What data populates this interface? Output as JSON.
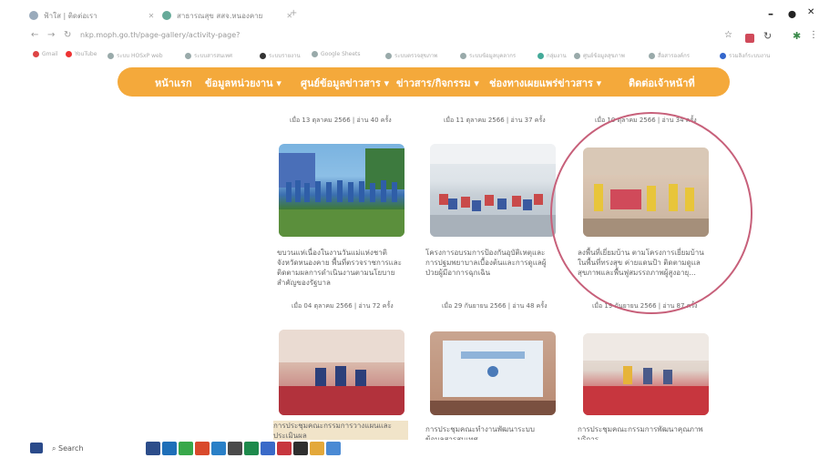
{
  "browser": {
    "tabs": [
      {
        "label": "ฟ้าใส | ติดต่อเรา"
      },
      {
        "label": "สาธารณสุข สสจ.หนองคาย"
      }
    ],
    "url": "nkp.moph.go.th/page-gallery/activity-page?",
    "new_tab": "+",
    "window_controls": {
      "minimize": "–",
      "maximize": "⬤",
      "close": "✕"
    },
    "bookmarks": [
      "Gmail",
      "YouTube",
      "ระบบ HOSxP web",
      "ระบบสารสนเทศ",
      "ระบบรายงาน",
      "Google Sheets",
      "ระบบตรวจสุขภาพ",
      "ระบบข้อมูลบุคลากร",
      "กลุ่มงาน",
      "ศูนย์ข้อมูลสุขภาพ",
      "สื่อสารองค์กร",
      "รวมลิงก์ระบบงาน"
    ]
  },
  "site_nav": {
    "items": [
      "หน้าแรก",
      "ข้อมูลหน่วยงาน ▾",
      "ศูนย์ข้อมูลข่าวสาร ▾",
      "ข่าวสาร/กิจกรรม ▾",
      "ช่องทางเผยแพร่ข่าวสาร ▾",
      "ติดต่อเจ้าหน้าที่"
    ]
  },
  "gallery": {
    "row1_meta": [
      "เมื่อ 13 ตุลาคม 2566 | อ่าน 40 ครั้ง",
      "เมื่อ 11 ตุลาคม 2566 | อ่าน 37 ครั้ง",
      "เมื่อ 10 ตุลาคม 2566 | อ่าน 34 ครั้ง"
    ],
    "cards": [
      {
        "title": "ขบวนแห่เนื่องในงานวันแม่แห่งชาติจังหวัดหนองคาย พื้นที่ตรวจราชการและติดตามผลการดำเนินงานตามนโยบายสำคัญของรัฐบาล",
        "meta": "เมื่อ 04 ตุลาคม 2566 | อ่าน 72 ครั้ง"
      },
      {
        "title": "โครงการอบรมการป้องกันอุบัติเหตุและการปฐมพยาบาลเบื้องต้นและการดูแลผู้ป่วยผู้มีอาการฉุกเฉิน",
        "meta": "เมื่อ 29 กันยายน 2566 | อ่าน 48 ครั้ง"
      },
      {
        "title": "ลงพื้นที่เยี่ยมบ้าน ตามโครงการเยี่ยมบ้านในพื้นที่ทรงสุข ค่ายแดนป้า ติดตามดูแลสุขภาพและพื้นฟูสมรรถภาพผู้สูงอายุ...",
        "meta": "เมื่อ 19 กันยายน 2566 | อ่าน 87 ครั้ง"
      }
    ],
    "row3_titles": [
      "การประชุมคณะกรรมการวางแผนและประเมินผล",
      "การประชุมคณะทำงานพัฒนาระบบข้อมูลสารสนเทศ",
      "การประชุมคณะกรรมการพัฒนาคุณภาพบริการ"
    ]
  },
  "taskbar": {
    "search": "Search"
  }
}
